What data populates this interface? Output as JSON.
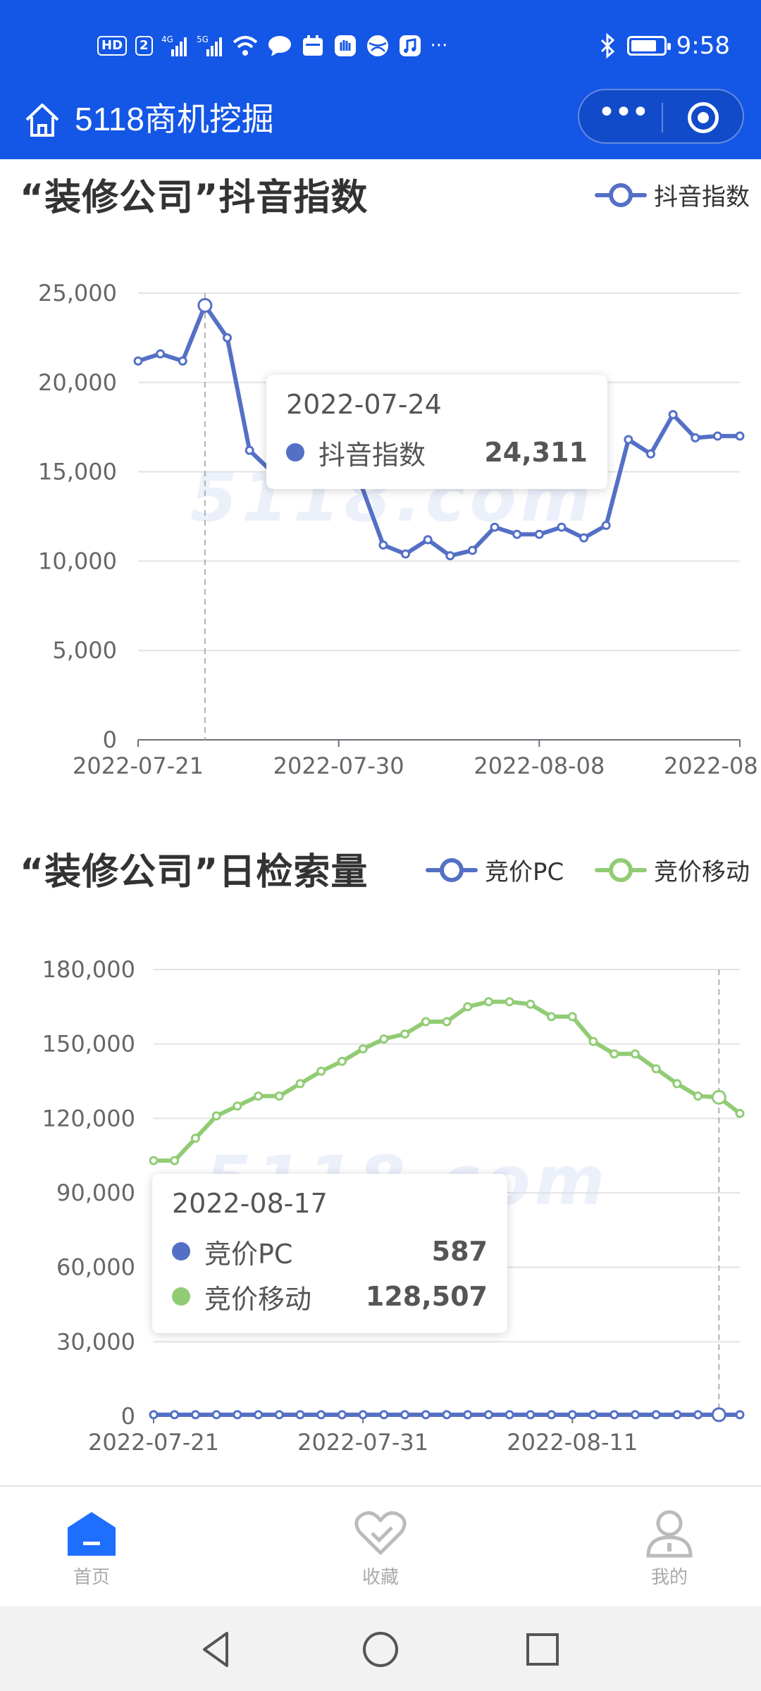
{
  "status_bar": {
    "time": "9:58",
    "badges": [
      "HD",
      "2",
      "4G",
      "5G"
    ],
    "icons": [
      "hd-icon",
      "sim-icon",
      "signal-4g-icon",
      "signal-5g-icon",
      "wifi-icon",
      "message-icon",
      "calendar-icon",
      "hand-icon",
      "globe-icon",
      "music-icon",
      "more-icon",
      "bluetooth-icon",
      "battery-icon"
    ],
    "ellipsis": "···",
    "battery_level": 0.8
  },
  "header": {
    "title": "5118商机挖掘",
    "home_icon": "home-icon",
    "more_icon": "more-dots-icon",
    "close_icon": "target-icon",
    "more_label": "•••",
    "bg_color": "#1456e6"
  },
  "chart1": {
    "title": "“装修公司”抖音指数",
    "legend": "抖音指数",
    "tooltip": {
      "date": "2022-07-24",
      "series": "抖音指数",
      "value": "24,311"
    }
  },
  "chart2": {
    "title": "“装修公司”日检索量",
    "legend": [
      "竞价PC",
      "竞价移动"
    ],
    "tooltip": {
      "date": "2022-08-17",
      "rows": [
        {
          "series": "竞价PC",
          "value": "587"
        },
        {
          "series": "竞价移动",
          "value": "128,507"
        }
      ]
    }
  },
  "watermark": "5118.com",
  "chart_data": [
    {
      "type": "line",
      "title": "“装修公司”抖音指数",
      "xlabel": "",
      "ylabel": "",
      "ylim": [
        0,
        25000
      ],
      "yticks": [
        "0",
        "5,000",
        "10,000",
        "15,000",
        "20,000",
        "25,000"
      ],
      "xtick_labels": [
        "2022-07-21",
        "2022-07-30",
        "2022-08-08",
        "2022-08"
      ],
      "x": [
        "2022-07-21",
        "2022-07-22",
        "2022-07-23",
        "2022-07-24",
        "2022-07-25",
        "2022-07-26",
        "2022-07-27",
        "2022-07-28",
        "2022-07-29",
        "2022-07-30",
        "2022-07-31",
        "2022-08-01",
        "2022-08-02",
        "2022-08-03",
        "2022-08-04",
        "2022-08-05",
        "2022-08-06",
        "2022-08-07",
        "2022-08-08",
        "2022-08-09",
        "2022-08-10",
        "2022-08-11",
        "2022-08-12",
        "2022-08-13",
        "2022-08-14",
        "2022-08-15",
        "2022-08-16",
        "2022-08-17"
      ],
      "series": [
        {
          "name": "抖音指数",
          "color": "#5470c6",
          "values": [
            21200,
            21600,
            21200,
            24311,
            22500,
            16200,
            15000,
            14500,
            14800,
            14600,
            14300,
            10900,
            10400,
            11200,
            10300,
            10600,
            11900,
            11500,
            11500,
            11900,
            11300,
            12000,
            16800,
            16000,
            18200,
            16900,
            17000,
            17000
          ]
        }
      ],
      "grid": true,
      "legend_position": "top-right"
    },
    {
      "type": "line",
      "title": "“装修公司”日检索量",
      "xlabel": "",
      "ylabel": "",
      "ylim": [
        0,
        180000
      ],
      "yticks": [
        "0",
        "30,000",
        "60,000",
        "90,000",
        "120,000",
        "150,000",
        "180,000"
      ],
      "xtick_labels": [
        "2022-07-21",
        "2022-07-31",
        "2022-08-11"
      ],
      "x": [
        "2022-07-21",
        "2022-07-22",
        "2022-07-23",
        "2022-07-24",
        "2022-07-25",
        "2022-07-26",
        "2022-07-27",
        "2022-07-28",
        "2022-07-29",
        "2022-07-30",
        "2022-07-31",
        "2022-08-01",
        "2022-08-02",
        "2022-08-03",
        "2022-08-04",
        "2022-08-05",
        "2022-08-06",
        "2022-08-07",
        "2022-08-08",
        "2022-08-09",
        "2022-08-10",
        "2022-08-11",
        "2022-08-12",
        "2022-08-13",
        "2022-08-14",
        "2022-08-15",
        "2022-08-16",
        "2022-08-17",
        "2022-08-18"
      ],
      "series": [
        {
          "name": "竞价PC",
          "color": "#5470c6",
          "values": [
            600,
            600,
            600,
            600,
            600,
            600,
            600,
            600,
            600,
            600,
            600,
            600,
            600,
            600,
            600,
            600,
            600,
            600,
            600,
            600,
            600,
            600,
            600,
            600,
            600,
            600,
            600,
            587,
            600
          ]
        },
        {
          "name": "竞价移动",
          "color": "#91cc75",
          "values": [
            103000,
            103000,
            112000,
            121000,
            125000,
            129000,
            129000,
            134000,
            139000,
            143000,
            148000,
            152000,
            154000,
            159000,
            159000,
            165000,
            167000,
            167000,
            166000,
            161000,
            161000,
            151000,
            146000,
            146000,
            140000,
            134000,
            129000,
            128507,
            122000
          ]
        }
      ],
      "grid": true,
      "legend_position": "top-right"
    }
  ],
  "tabbar": {
    "items": [
      {
        "label": "首页",
        "icon": "home-tab-icon",
        "active": true
      },
      {
        "label": "收藏",
        "icon": "favorite-icon",
        "active": false
      },
      {
        "label": "我的",
        "icon": "profile-icon",
        "active": false
      }
    ],
    "active_color": "#1e6fff"
  },
  "navbar": {
    "icons": [
      "back-icon",
      "home-circle-icon",
      "recent-apps-icon"
    ]
  }
}
